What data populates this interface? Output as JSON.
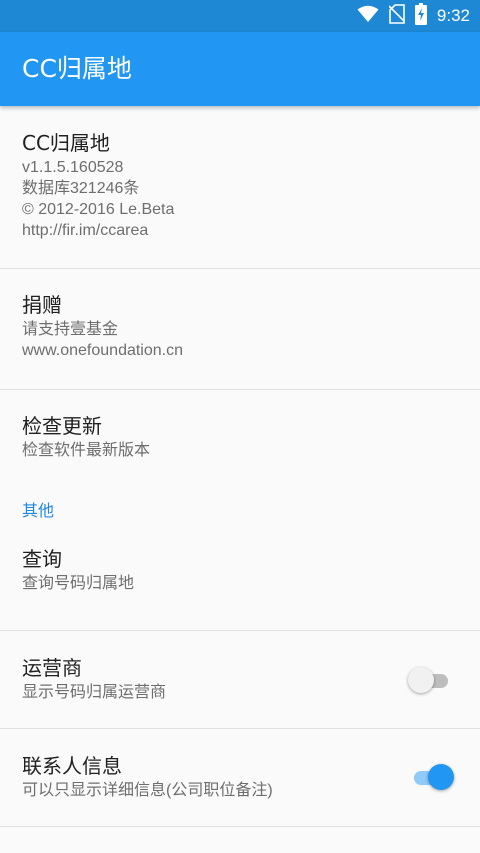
{
  "status_bar": {
    "time": "9:32",
    "icons": [
      "wifi-icon",
      "no-sim-icon",
      "battery-charging-icon"
    ]
  },
  "app_bar": {
    "title": "CC归属地"
  },
  "about": {
    "title": "CC归属地",
    "lines": [
      "v1.1.5.160528",
      "数据库321246条",
      "© 2012-2016 Le.Beta",
      "http://fir.im/ccarea"
    ]
  },
  "donate": {
    "title": "捐赠",
    "lines": [
      "请支持壹基金",
      "www.onefoundation.cn"
    ]
  },
  "update": {
    "title": "检查更新",
    "summary": "检查软件最新版本"
  },
  "category_other": "其他",
  "query": {
    "title": "查询",
    "summary": "查询号码归属地"
  },
  "carrier": {
    "title": "运营商",
    "summary": "显示号码归属运营商",
    "enabled": false
  },
  "contact_info": {
    "title": "联系人信息",
    "summary": "可以只显示详细信息(公司职位备注)",
    "enabled": true
  },
  "colors": {
    "status_bar": "#1e88d5",
    "app_bar": "#2196f3",
    "accent": "#1e88e5",
    "background": "#fafafa"
  }
}
